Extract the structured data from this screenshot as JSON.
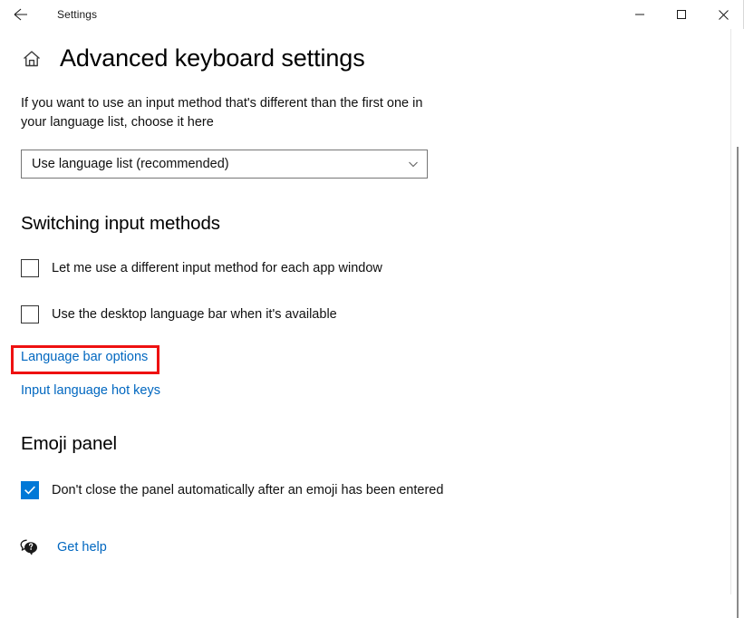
{
  "window": {
    "app_title": "Settings",
    "back_icon": "back-arrow-icon",
    "minimize_label": "Minimize",
    "maximize_label": "Maximize",
    "close_label": "Close"
  },
  "page": {
    "home_icon": "home-icon",
    "title": "Advanced keyboard settings",
    "description": "If you want to use an input method that's different than the first one in your language list, choose it here"
  },
  "override_input_method": {
    "selected": "Use language list (recommended)",
    "chevron_icon": "chevron-down-icon"
  },
  "switching": {
    "heading": "Switching input methods",
    "checkbox_app_window": {
      "label": "Let me use a different input method for each app window",
      "checked": false
    },
    "checkbox_desktop_language_bar": {
      "label": "Use the desktop language bar when it's available",
      "checked": false
    },
    "link_language_bar_options": "Language bar options",
    "link_input_language_hot_keys": "Input language hot keys"
  },
  "emoji": {
    "heading": "Emoji panel",
    "checkbox_dont_close": {
      "label": "Don't close the panel automatically after an emoji has been entered",
      "checked": true
    }
  },
  "footer": {
    "help_icon": "help-speech-bubble-icon",
    "get_help_label": "Get help"
  },
  "annotation": {
    "target": "Language bar options",
    "color": "#ee1111"
  },
  "colors": {
    "accent": "#0078d7",
    "link": "#0067c0",
    "annotation": "#ee1111"
  }
}
